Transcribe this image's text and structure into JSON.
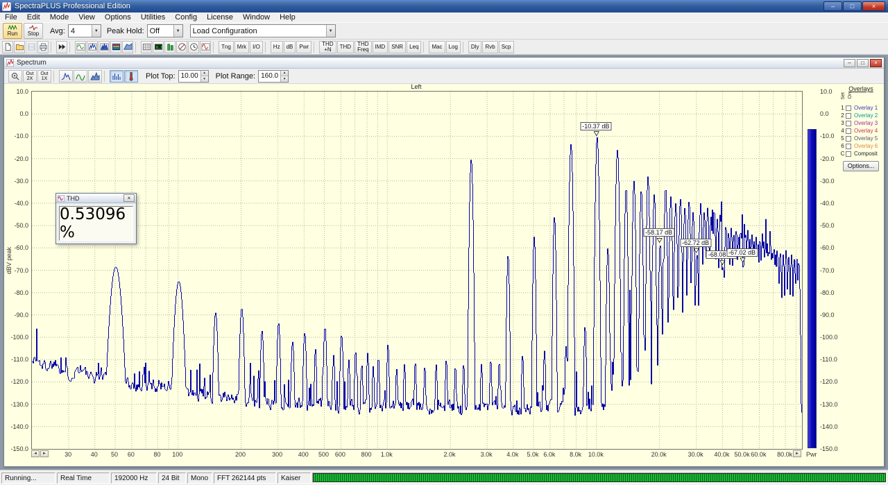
{
  "app": {
    "title": "SpectraPLUS Professional Edition"
  },
  "glyphs": {
    "minimize": "–",
    "maximize": "□",
    "close": "×",
    "child_min": "–",
    "child_max": "□",
    "child_close": "×",
    "dropdown": "▼",
    "spin_up": "▲",
    "spin_down": "▼",
    "scroll_left": "◄",
    "scroll_right": "►",
    "thd_close": "×"
  },
  "menu": {
    "items": [
      "File",
      "Edit",
      "Mode",
      "View",
      "Options",
      "Utilities",
      "Config",
      "License",
      "Window",
      "Help"
    ]
  },
  "toolbar_top": {
    "run": "Run",
    "stop": "Stop",
    "avg_label": "Avg:",
    "avg_value": "4",
    "peak_hold_label": "Peak Hold:",
    "peak_hold_value": "Off",
    "config_value": "Load Configuration"
  },
  "toolbar_icons": {
    "buttons": [
      {
        "icon": "new-file-icon"
      },
      {
        "icon": "open-folder-icon"
      },
      {
        "icon": "save-icon",
        "disabled": true
      },
      {
        "icon": "print-icon"
      },
      {
        "sep": true
      },
      {
        "icon": "fast-forward-icon"
      },
      {
        "sep": true
      },
      {
        "icon": "time-series-icon"
      },
      {
        "icon": "spectrum-icon"
      },
      {
        "icon": "spectrum-filled-icon"
      },
      {
        "icon": "spectrogram-icon"
      },
      {
        "icon": "surface-3d-icon"
      },
      {
        "sep": true
      },
      {
        "icon": "table-icon"
      },
      {
        "icon": "digits-icon"
      },
      {
        "icon": "level-meter-icon"
      },
      {
        "icon": "phase-icon"
      },
      {
        "icon": "clock-icon"
      },
      {
        "icon": "signal-generator-icon"
      },
      {
        "sep": true
      },
      {
        "label": "Tng"
      },
      {
        "label": "Mrk"
      },
      {
        "label": "I/O"
      },
      {
        "sep": true
      },
      {
        "label": "Hz"
      },
      {
        "label": "dB"
      },
      {
        "label": "Pwr"
      },
      {
        "sep": true
      },
      {
        "label": "THD\n+N"
      },
      {
        "label": "THD"
      },
      {
        "label": "THD\nFreq"
      },
      {
        "label": "IMD"
      },
      {
        "label": "SNR"
      },
      {
        "label": "Leq"
      },
      {
        "sep": true
      },
      {
        "label": "Mac"
      },
      {
        "label": "Log"
      },
      {
        "sep": true
      },
      {
        "label": "Dly"
      },
      {
        "label": "Rvb"
      },
      {
        "label": "Scp"
      }
    ]
  },
  "spectrum_window": {
    "title": "Spectrum",
    "toolbar": {
      "zoom_out_2x": "Out\n2X",
      "zoom_out_1x": "Out\n1X",
      "plot_top_label": "Plot Top:",
      "plot_top_value": "10.00",
      "plot_range_label": "Plot Range:",
      "plot_range_value": "160.0"
    },
    "channel_label": "Left",
    "pwr_label": "Pwr",
    "overlays": {
      "title": "Overlays",
      "col_set": "Set",
      "col_on": "On",
      "rows": [
        {
          "num": "1",
          "label": "Overlay 1",
          "color": "#3a3ab8"
        },
        {
          "num": "2",
          "label": "Overlay 2",
          "color": "#009a9a"
        },
        {
          "num": "3",
          "label": "Overlay 3",
          "color": "#993399"
        },
        {
          "num": "4",
          "label": "Overlay 4",
          "color": "#cc3355"
        },
        {
          "num": "5",
          "label": "Overlay 5",
          "color": "#555577"
        },
        {
          "num": "6",
          "label": "Overlay 6",
          "color": "#dd8844"
        },
        {
          "num": "C",
          "label": "Composit",
          "color": "#222222"
        }
      ],
      "options_button": "Options..."
    }
  },
  "thd_window": {
    "title": "THD",
    "value": "0.53096 %"
  },
  "status_bar": {
    "segments": [
      "Running...",
      "Real Time",
      "192000 Hz",
      "24 Bit",
      "Mono",
      "FFT 262144 pts",
      "Kaiser"
    ]
  },
  "chart_data": {
    "type": "line",
    "title": "Left",
    "ylabel": "dBV peak",
    "x_scale": "log",
    "x_range_hz": [
      20,
      96000
    ],
    "y_range_db": [
      10,
      -150
    ],
    "y_ticks": [
      10,
      0,
      -10,
      -20,
      -30,
      -40,
      -50,
      -60,
      -70,
      -80,
      -90,
      -100,
      -110,
      -120,
      -130,
      -140,
      -150
    ],
    "grid": true,
    "trace_color": "#0505a8",
    "background": "#ffffe1",
    "grid_color": "#b5b5a0",
    "power_bar_top_db": -7,
    "x_ticks": [
      {
        "hz": 30,
        "label": "30"
      },
      {
        "hz": 40,
        "label": "40"
      },
      {
        "hz": 50,
        "label": "50"
      },
      {
        "hz": 60,
        "label": "60"
      },
      {
        "hz": 80,
        "label": "80"
      },
      {
        "hz": 100,
        "label": "100"
      },
      {
        "hz": 200,
        "label": "200"
      },
      {
        "hz": 300,
        "label": "300"
      },
      {
        "hz": 400,
        "label": "400"
      },
      {
        "hz": 500,
        "label": "500"
      },
      {
        "hz": 600,
        "label": "600"
      },
      {
        "hz": 800,
        "label": "800"
      },
      {
        "hz": 1000,
        "label": "1.0k"
      },
      {
        "hz": 2000,
        "label": "2.0k"
      },
      {
        "hz": 3000,
        "label": "3.0k"
      },
      {
        "hz": 4000,
        "label": "4.0k"
      },
      {
        "hz": 5000,
        "label": "5.0k"
      },
      {
        "hz": 6000,
        "label": "6.0k"
      },
      {
        "hz": 8000,
        "label": "8.0k"
      },
      {
        "hz": 10000,
        "label": "10.0k"
      },
      {
        "hz": 20000,
        "label": "20.0k"
      },
      {
        "hz": 30000,
        "label": "30.0k"
      },
      {
        "hz": 40000,
        "label": "40.0k"
      },
      {
        "hz": 50000,
        "label": "50.0k"
      },
      {
        "hz": 60000,
        "label": "60.0k"
      },
      {
        "hz": 80000,
        "label": "80.0k"
      }
    ],
    "markers": [
      {
        "f": 10000,
        "db": -10.37,
        "label": "-10.37 dB"
      },
      {
        "f": 20000,
        "db": -58.17,
        "label": "-58.17 dB"
      },
      {
        "f": 30000,
        "db": -62.72,
        "label": "-62.72 dB"
      },
      {
        "f": 40000,
        "db": -68.08,
        "label": "-68.08 dB"
      },
      {
        "f": 50000,
        "db": -67.02,
        "label": "-67.02 dB"
      }
    ],
    "noise_floor": [
      [
        20,
        -109
      ],
      [
        23,
        -113
      ],
      [
        26,
        -111
      ],
      [
        30,
        -117
      ],
      [
        34,
        -113
      ],
      [
        38,
        -119
      ],
      [
        43,
        -116
      ],
      [
        55,
        -120
      ],
      [
        60,
        -121
      ],
      [
        70,
        -122
      ],
      [
        85,
        -121
      ],
      [
        120,
        -126
      ],
      [
        170,
        -127
      ],
      [
        250,
        -129
      ],
      [
        400,
        -130
      ],
      [
        700,
        -131
      ],
      [
        1500,
        -131
      ],
      [
        3000,
        -132
      ],
      [
        6000,
        -132
      ],
      [
        12000,
        -132
      ],
      [
        30000,
        -133
      ],
      [
        96000,
        -133
      ]
    ],
    "peaks": [
      [
        50,
        -68.5,
        13
      ],
      [
        100,
        -75,
        10
      ],
      [
        150,
        -89,
        5
      ],
      [
        200,
        -87,
        5
      ],
      [
        250,
        -97,
        4
      ],
      [
        300,
        -93.5,
        4
      ],
      [
        350,
        -102,
        4
      ],
      [
        400,
        -98,
        4
      ],
      [
        450,
        -105,
        3
      ],
      [
        500,
        -95.5,
        4
      ],
      [
        550,
        -108,
        3
      ],
      [
        600,
        -99,
        4
      ],
      [
        650,
        -110,
        3
      ],
      [
        700,
        -106,
        3
      ],
      [
        750,
        -112,
        3
      ],
      [
        800,
        -107,
        3
      ],
      [
        850,
        -113,
        3
      ],
      [
        900,
        -109,
        3
      ],
      [
        1000,
        -103,
        3
      ],
      [
        1100,
        -114,
        3
      ],
      [
        1200,
        -112,
        3
      ],
      [
        1350,
        -111,
        3
      ],
      [
        1500,
        -113,
        3
      ],
      [
        1700,
        -112,
        3
      ],
      [
        1900,
        -110,
        3
      ],
      [
        2100,
        -113,
        3
      ],
      [
        2300,
        -112,
        3
      ],
      [
        2500,
        -20.3,
        3.5
      ],
      [
        2800,
        -112,
        3
      ],
      [
        3100,
        -110,
        3
      ],
      [
        3400,
        -111,
        3
      ],
      [
        3750,
        -63,
        3
      ],
      [
        4400,
        -108,
        3
      ],
      [
        5000,
        -55,
        3
      ],
      [
        5600,
        -106,
        3
      ],
      [
        6250,
        -46,
        3
      ],
      [
        7100,
        -104,
        3
      ],
      [
        7500,
        -13.5,
        3.5
      ],
      [
        8750,
        -95,
        3
      ],
      [
        10000,
        -10.37,
        3.5
      ],
      [
        11250,
        -60,
        3
      ],
      [
        12500,
        -16.2,
        3.5
      ],
      [
        13750,
        -33,
        3
      ],
      [
        15000,
        -30,
        3
      ],
      [
        16250,
        -34,
        3
      ],
      [
        17500,
        -28,
        3
      ],
      [
        18750,
        -36,
        3
      ],
      [
        20000,
        -58.17,
        3
      ],
      [
        21250,
        -33,
        3
      ],
      [
        22500,
        -37,
        3
      ],
      [
        23750,
        -40,
        3
      ],
      [
        25000,
        -38,
        3
      ],
      [
        26250,
        -42,
        3
      ],
      [
        27500,
        -39,
        3
      ],
      [
        28750,
        -44,
        3
      ],
      [
        30000,
        -62.72,
        3
      ],
      [
        31250,
        -40,
        3
      ],
      [
        32500,
        -44,
        3
      ],
      [
        33750,
        -42,
        3
      ],
      [
        35000,
        -46,
        3
      ],
      [
        36250,
        -43,
        3
      ],
      [
        37500,
        -47,
        3
      ],
      [
        38750,
        -45,
        3
      ],
      [
        40000,
        -68.08,
        3
      ],
      [
        41250,
        -50,
        3
      ],
      [
        42500,
        -53,
        3
      ],
      [
        43750,
        -51,
        3
      ],
      [
        45000,
        -54,
        3
      ],
      [
        46250,
        -52,
        3
      ],
      [
        47500,
        -55,
        3
      ],
      [
        48750,
        -53,
        3
      ],
      [
        50000,
        -67.02,
        3
      ],
      [
        51250,
        -54,
        3
      ],
      [
        52500,
        -52,
        3
      ],
      [
        53750,
        -56,
        3
      ],
      [
        55000,
        -54,
        3
      ],
      [
        56250,
        -57,
        3
      ],
      [
        57500,
        -55,
        3
      ],
      [
        58750,
        -58,
        3
      ],
      [
        60000,
        -56,
        3
      ],
      [
        61250,
        -59,
        3
      ],
      [
        62500,
        -57,
        3
      ],
      [
        63750,
        -60,
        3
      ],
      [
        65000,
        -58,
        3
      ],
      [
        66250,
        -61,
        3
      ],
      [
        67500,
        -59,
        3
      ],
      [
        68750,
        -62,
        3
      ],
      [
        70000,
        -60,
        3
      ],
      [
        71250,
        -63,
        3
      ],
      [
        72500,
        -61,
        3
      ],
      [
        75000,
        -62,
        3
      ],
      [
        77500,
        -63,
        3
      ],
      [
        80000,
        -61,
        3
      ],
      [
        82500,
        -64,
        3
      ],
      [
        85000,
        -63,
        3
      ],
      [
        87500,
        -65,
        3
      ],
      [
        90000,
        -64,
        3
      ],
      [
        92000,
        -66,
        3
      ]
    ],
    "dense_band": {
      "f_start": 11000,
      "f_end": 93000,
      "top_env": [
        [
          11000,
          -112
        ],
        [
          13000,
          -107
        ],
        [
          15000,
          -101
        ],
        [
          17000,
          -97
        ],
        [
          19000,
          -93
        ],
        [
          22000,
          -86
        ],
        [
          26000,
          -78
        ],
        [
          30000,
          -73
        ],
        [
          35000,
          -69
        ],
        [
          40000,
          -67
        ],
        [
          46000,
          -66
        ],
        [
          52000,
          -68
        ],
        [
          58000,
          -70
        ],
        [
          64000,
          -72
        ],
        [
          72000,
          -76
        ],
        [
          80000,
          -81
        ],
        [
          88000,
          -88
        ],
        [
          93000,
          -93
        ]
      ],
      "spike_probability": 0.1,
      "spike_extra_db": [
        8,
        28
      ]
    }
  }
}
